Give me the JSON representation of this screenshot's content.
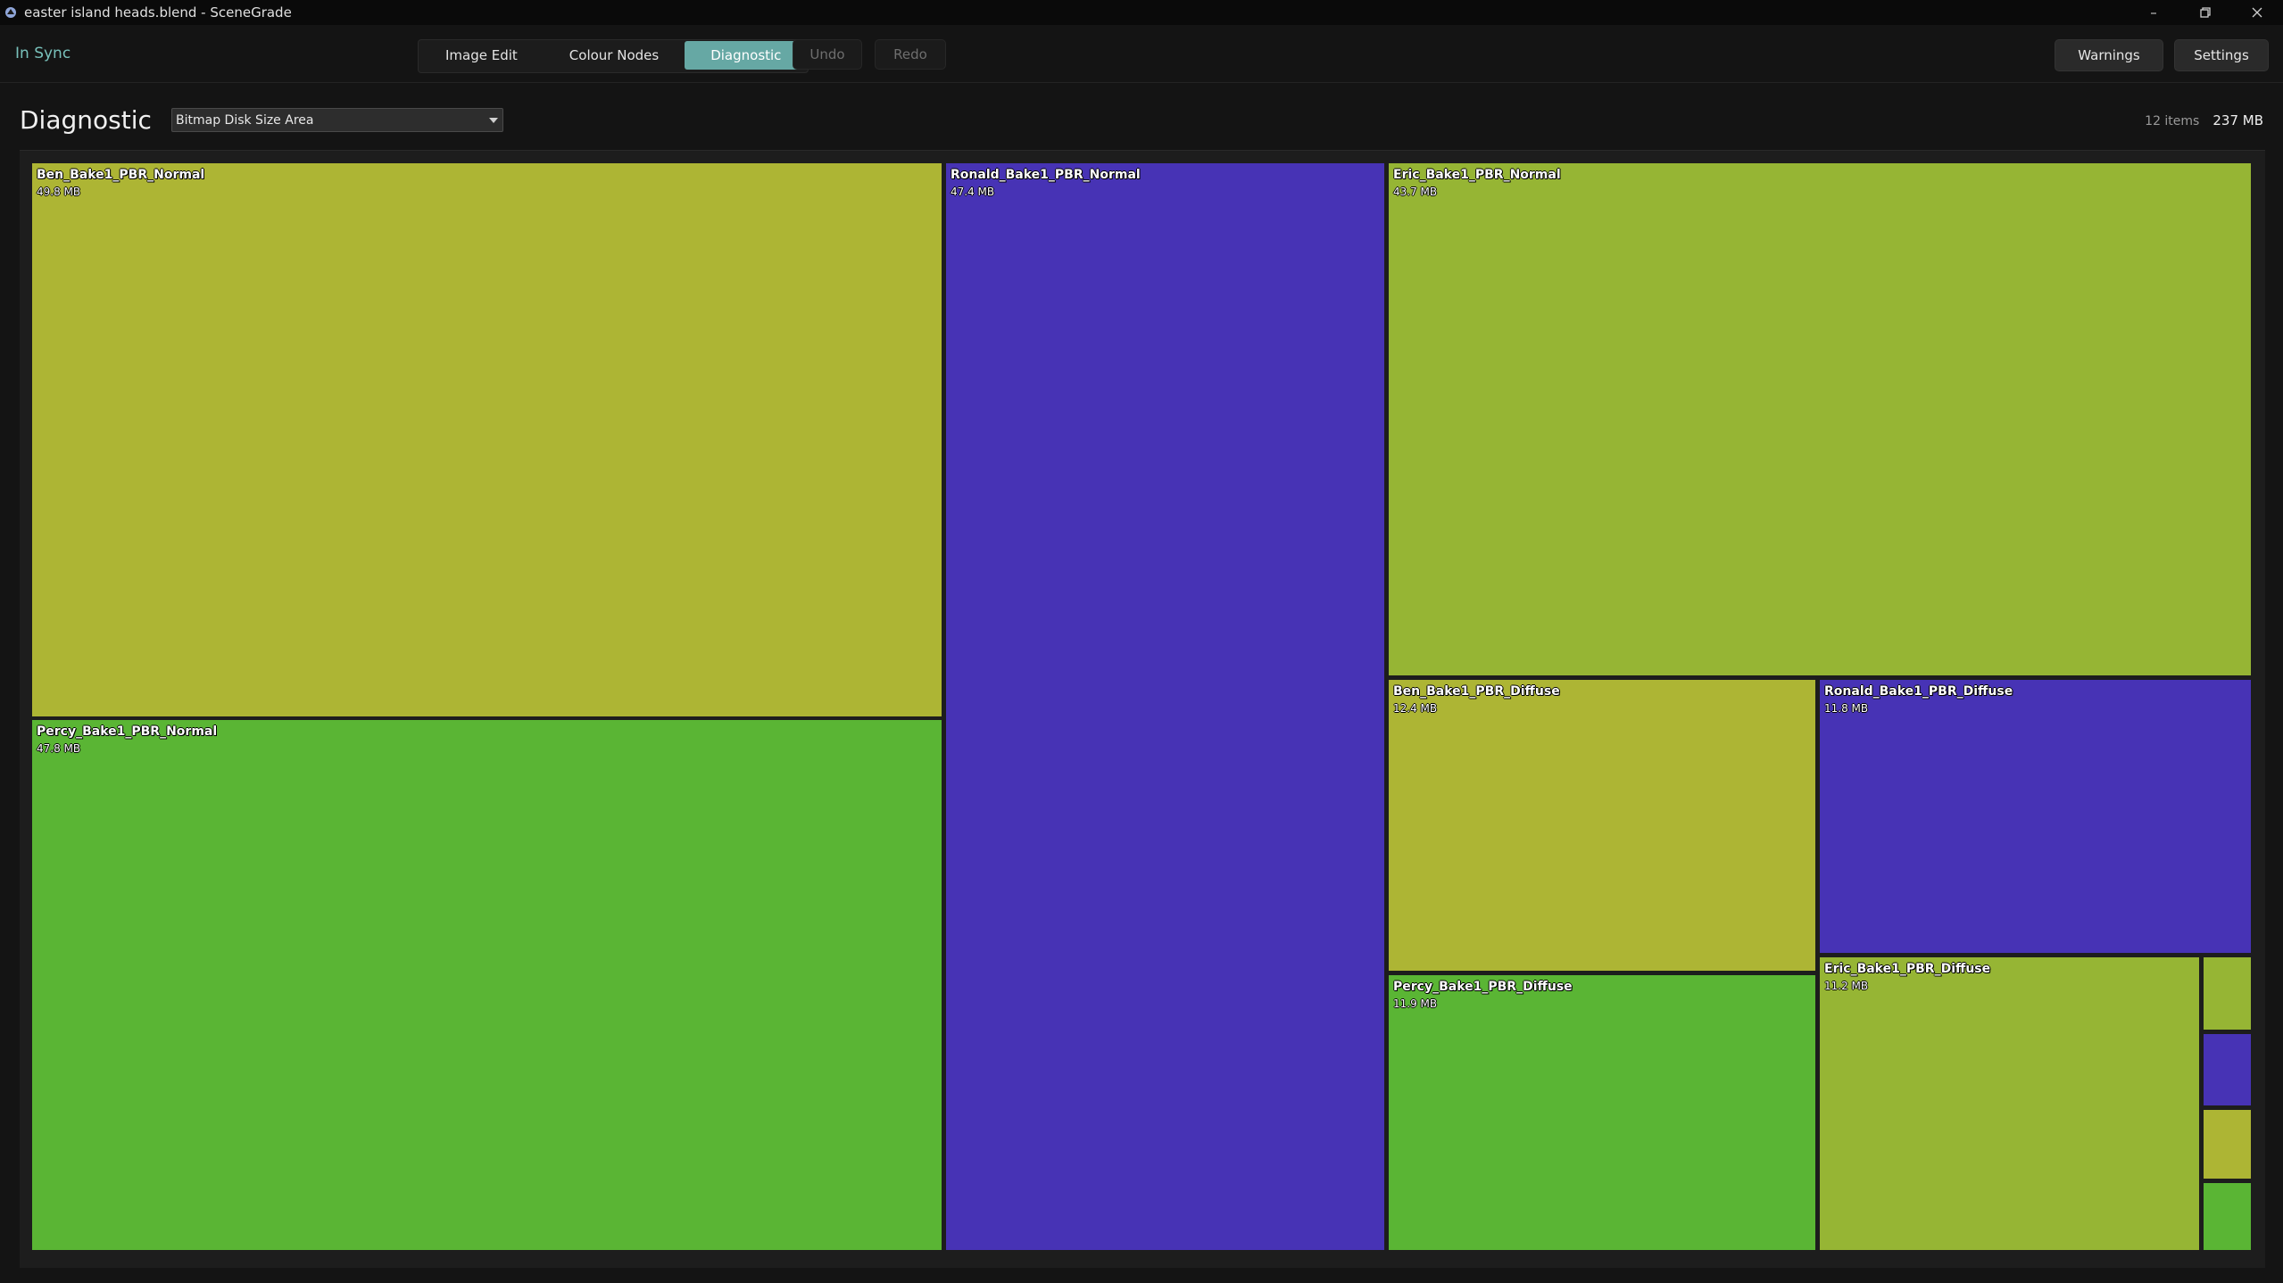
{
  "window": {
    "title": "easter island heads.blend - SceneGrade",
    "controls": [
      "minimize-icon",
      "restore-icon",
      "close-icon"
    ]
  },
  "toolbar": {
    "status": "In Sync",
    "tabs": [
      {
        "label": "Image Edit",
        "active": false
      },
      {
        "label": "Colour Nodes",
        "active": false
      },
      {
        "label": "Diagnostic",
        "active": true
      }
    ],
    "undo_label": "Undo",
    "redo_label": "Redo",
    "warnings_label": "Warnings",
    "settings_label": "Settings"
  },
  "panel": {
    "title": "Diagnostic",
    "mode_select": "Bitmap Disk Size Area",
    "item_count": "12 items",
    "total_size": "237 MB"
  },
  "colors": {
    "yellow": "#adb534",
    "blue": "#4733b5",
    "lime": "#96b534",
    "green": "#5ab534",
    "accent": "#66a8a4"
  },
  "treemap": [
    {
      "name": "Ben_Bake1_PBR_Normal",
      "size": "49.8 MB",
      "color": "yellow"
    },
    {
      "name": "Percy_Bake1_PBR_Normal",
      "size": "47.8 MB",
      "color": "green"
    },
    {
      "name": "Ronald_Bake1_PBR_Normal",
      "size": "47.4 MB",
      "color": "blue"
    },
    {
      "name": "Eric_Bake1_PBR_Normal",
      "size": "43.7 MB",
      "color": "lime"
    },
    {
      "name": "Ben_Bake1_PBR_Diffuse",
      "size": "12.4 MB",
      "color": "yellow"
    },
    {
      "name": "Percy_Bake1_PBR_Diffuse",
      "size": "11.9 MB",
      "color": "green"
    },
    {
      "name": "Ronald_Bake1_PBR_Diffuse",
      "size": "11.8 MB",
      "color": "blue"
    },
    {
      "name": "Eric_Bake1_PBR_Diffuse",
      "size": "11.2 MB",
      "color": "lime"
    },
    {
      "name": "",
      "size": "",
      "color": "lime"
    },
    {
      "name": "",
      "size": "",
      "color": "blue"
    },
    {
      "name": "",
      "size": "",
      "color": "yellow"
    },
    {
      "name": "",
      "size": "",
      "color": "green"
    }
  ]
}
